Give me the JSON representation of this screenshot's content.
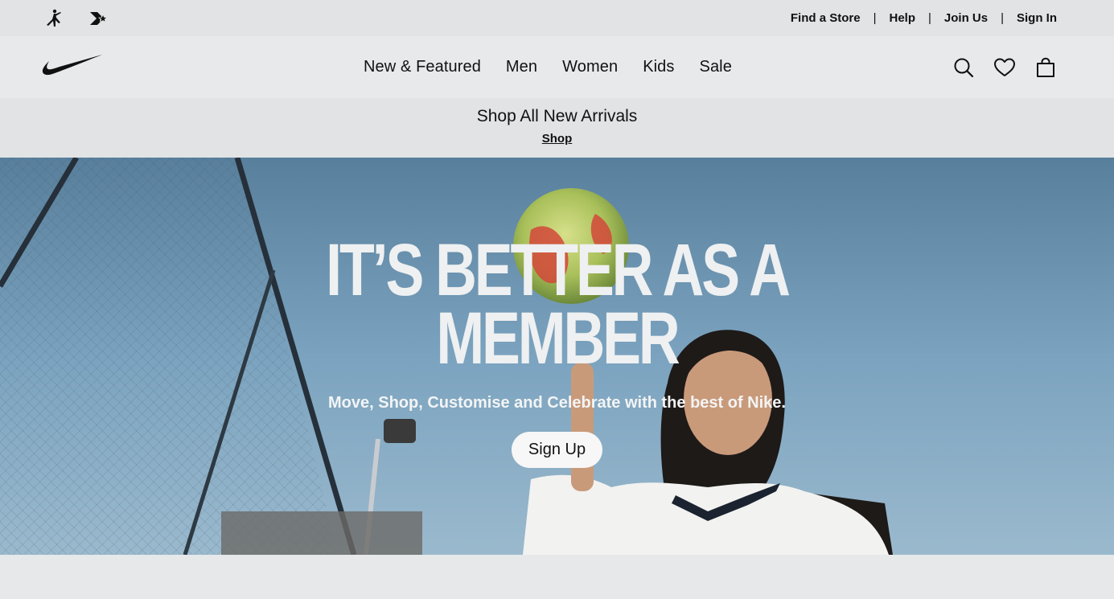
{
  "utility_bar": {
    "brand_icons": [
      "jordan-jumpman-icon",
      "converse-star-chevron-icon"
    ],
    "links": [
      "Find a Store",
      "Help",
      "Join Us",
      "Sign In"
    ],
    "separator": "|"
  },
  "main_nav": {
    "logo": "nike-swoosh-icon",
    "menu": [
      "New & Featured",
      "Men",
      "Women",
      "Kids",
      "Sale"
    ],
    "actions": [
      "search-icon",
      "heart-icon",
      "bag-icon"
    ]
  },
  "promo": {
    "title": "Shop All New Arrivals",
    "link": "Shop"
  },
  "hero": {
    "headline_line1": "IT’S BETTER AS A",
    "headline_line2": "MEMBER",
    "subtitle": "Move, Shop, Customise and Celebrate with the best of Nike.",
    "cta": "Sign Up"
  },
  "colors": {
    "background": "#e5e7e9",
    "text": "#111111",
    "sky": "#79a3bf",
    "headline": "#eef0f1"
  }
}
